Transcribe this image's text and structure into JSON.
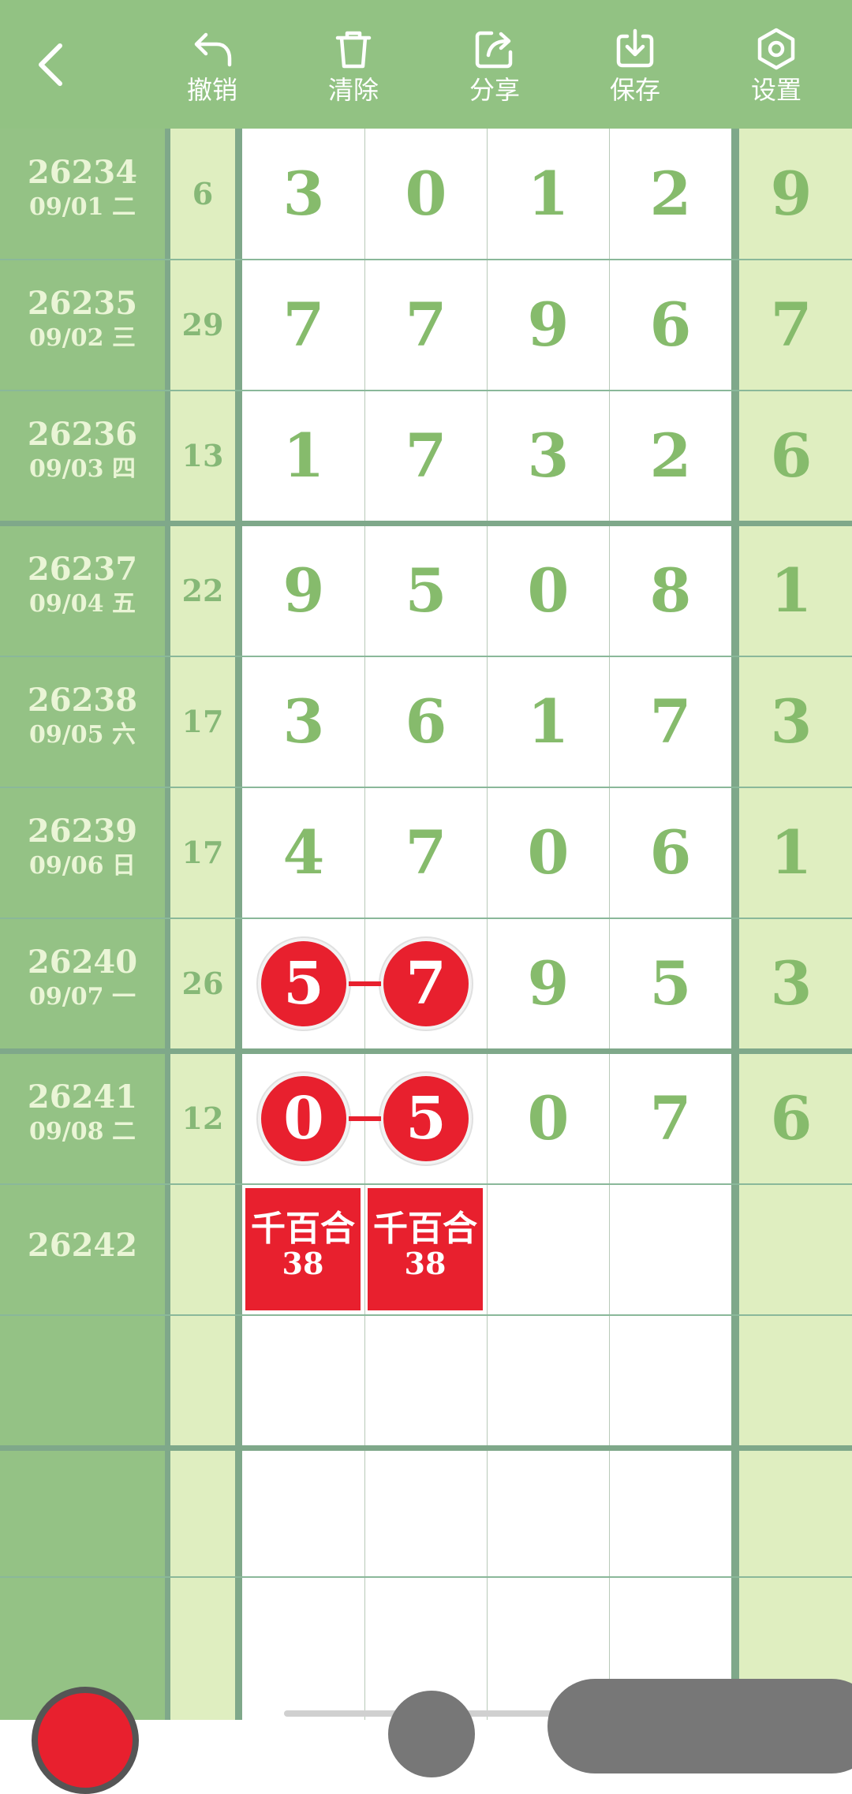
{
  "toolbar": {
    "back_icon": "chevron-left-icon",
    "tools": [
      {
        "label": "撤销",
        "icon": "undo-icon"
      },
      {
        "label": "清除",
        "icon": "trash-icon"
      },
      {
        "label": "分享",
        "icon": "share-icon"
      },
      {
        "label": "保存",
        "icon": "download-icon"
      },
      {
        "label": "设置",
        "icon": "gear-icon"
      }
    ]
  },
  "rows": [
    {
      "issue": "26234",
      "date": "09/01 二",
      "sum": "6",
      "digits": [
        "3",
        "0",
        "1",
        "2"
      ],
      "tail": "9"
    },
    {
      "issue": "26235",
      "date": "09/02 三",
      "sum": "29",
      "digits": [
        "7",
        "7",
        "9",
        "6"
      ],
      "tail": "7"
    },
    {
      "issue": "26236",
      "date": "09/03 四",
      "sum": "13",
      "digits": [
        "1",
        "7",
        "3",
        "2"
      ],
      "tail": "6"
    },
    {
      "issue": "26237",
      "date": "09/04 五",
      "sum": "22",
      "digits": [
        "9",
        "5",
        "0",
        "8"
      ],
      "tail": "1"
    },
    {
      "issue": "26238",
      "date": "09/05 六",
      "sum": "17",
      "digits": [
        "3",
        "6",
        "1",
        "7"
      ],
      "tail": "3"
    },
    {
      "issue": "26239",
      "date": "09/06 日",
      "sum": "17",
      "digits": [
        "4",
        "7",
        "0",
        "6"
      ],
      "tail": "1"
    },
    {
      "issue": "26240",
      "date": "09/07 一",
      "sum": "26",
      "digits": [
        "5",
        "7",
        "9",
        "5"
      ],
      "tail": "3",
      "marked": [
        0,
        1
      ]
    },
    {
      "issue": "26241",
      "date": "09/08 二",
      "sum": "12",
      "digits": [
        "0",
        "5",
        "0",
        "7"
      ],
      "tail": "6",
      "marked": [
        0,
        1
      ]
    },
    {
      "issue": "26242",
      "date": "",
      "sum": "",
      "digits": [
        "",
        "",
        "",
        ""
      ],
      "tail": ""
    }
  ],
  "tags": [
    {
      "top": "千百合",
      "bottom": "38"
    },
    {
      "top": "千百合",
      "bottom": "38"
    }
  ],
  "colors": {
    "toolbar_bg": "#92c283",
    "issue_col_bg": "#94c285",
    "light_col_bg": "#dfeec0",
    "digit_green": "#86bb6c",
    "highlight_red": "#e8202e"
  }
}
